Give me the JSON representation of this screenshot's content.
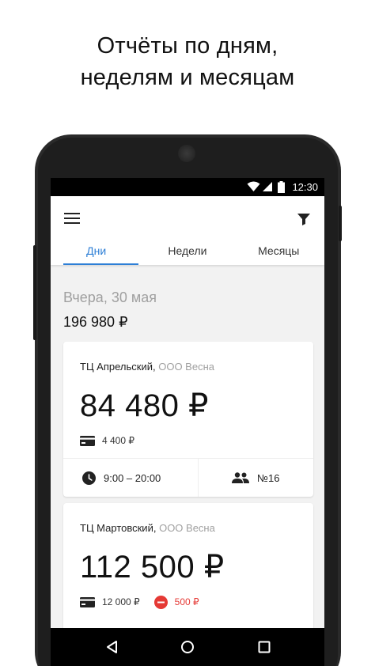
{
  "promo": {
    "line1": "Отчёты по дням,",
    "line2": "неделям и месяцам"
  },
  "status_bar": {
    "time": "12:30"
  },
  "app_bar": {
    "menu_icon": "menu-icon",
    "filter_icon": "filter-icon"
  },
  "tabs": [
    {
      "label": "Дни",
      "active": true
    },
    {
      "label": "Недели",
      "active": false
    },
    {
      "label": "Месяцы",
      "active": false
    }
  ],
  "summary": {
    "date": "Вчера, 30 мая",
    "total": "196 980 ₽"
  },
  "cards": [
    {
      "store": "ТЦ Апрельский,",
      "org": "ООО Весна",
      "amount": "84 480 ₽",
      "card_payment": "4 400 ₽",
      "hours": "9:00 – 20:00",
      "shift": "№16"
    },
    {
      "store": "ТЦ Мартовский,",
      "org": "ООО Весна",
      "amount": "112 500 ₽",
      "card_payment": "12 000 ₽",
      "refund": "500 ₽"
    }
  ],
  "colors": {
    "accent": "#2e7fd6",
    "refund": "#e53935",
    "muted": "#a0a0a0"
  }
}
